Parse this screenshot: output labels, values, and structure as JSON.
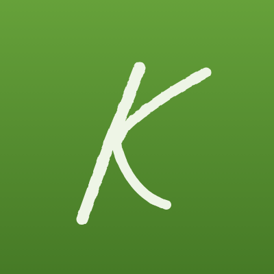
{
  "app_icon": {
    "logo_letter": "K",
    "icon_name": "k-letter-logo-icon",
    "colors": {
      "background_top": "#66a13a",
      "background_bottom": "#467a26",
      "letter": "#eef5e6"
    }
  }
}
